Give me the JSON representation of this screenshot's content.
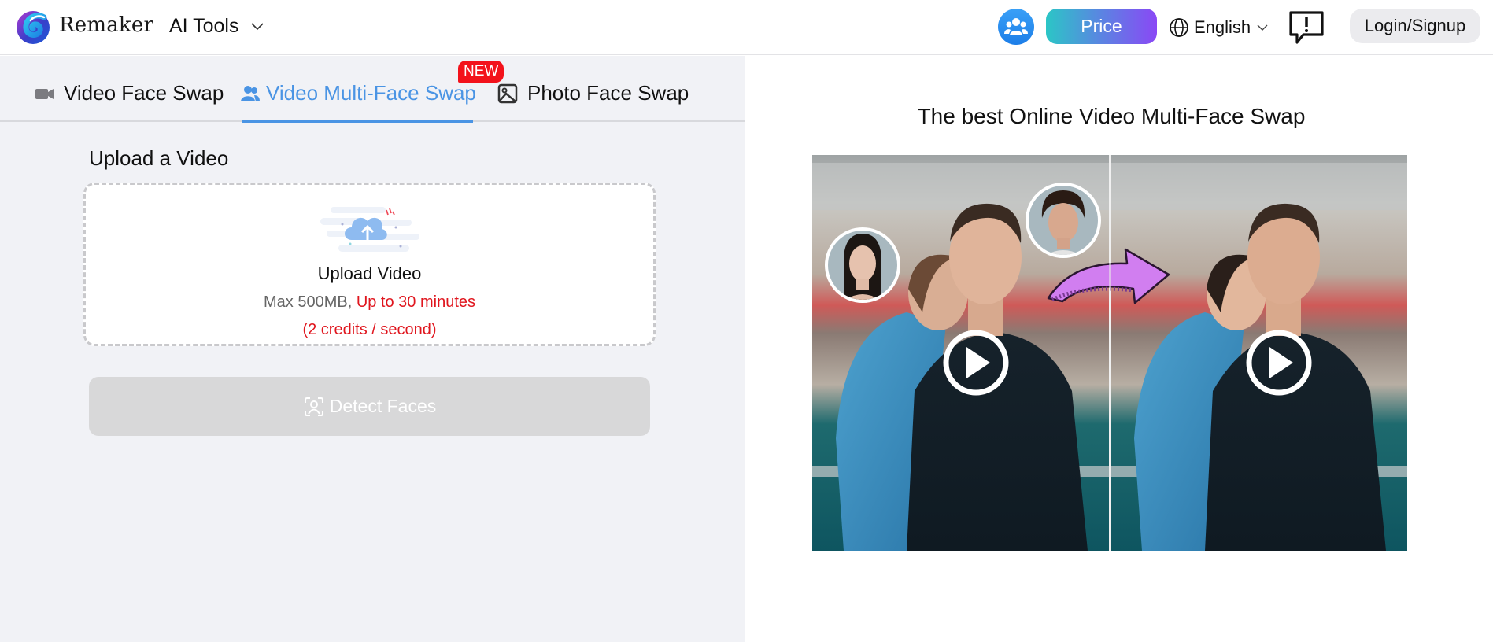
{
  "header": {
    "brand": "Remaker",
    "ai_tools_label": "AI Tools",
    "price_label": "Price",
    "language": "English",
    "login_label": "Login/Signup",
    "icons": {
      "logo": "remaker-swirl-logo",
      "community": "users-group-icon",
      "language": "globe-icon",
      "feedback": "feedback-exclamation-icon"
    },
    "colors": {
      "price_gradient_start": "#2bc6c6",
      "price_gradient_end": "#8a48f5",
      "community_blue": "#2a8ff0"
    }
  },
  "tabs": [
    {
      "label": "Video Face Swap",
      "icon": "video-camera-icon",
      "active": false
    },
    {
      "label": "Video Multi-Face Swap",
      "icon": "users-icon",
      "active": true,
      "badge": "NEW"
    },
    {
      "label": "Photo Face Swap",
      "icon": "image-icon",
      "active": false
    }
  ],
  "upload": {
    "section_title": "Upload a Video",
    "dropzone_title": "Upload Video",
    "max_size": "Max 500MB,",
    "duration_limit": "Up to 30 minutes",
    "credits_note": "(2 credits / second)"
  },
  "detect_button": {
    "label": "Detect Faces",
    "disabled": true
  },
  "preview": {
    "title": "The best Online Video Multi-Face Swap",
    "play_icon": "play-circle-icon",
    "swap_arrow_icon": "curved-arrow-icon"
  },
  "colors": {
    "accent": "#4a94e4",
    "badge_red": "#f3121b",
    "warning_red": "#e0161e",
    "panel_bg": "#f1f2f6"
  }
}
